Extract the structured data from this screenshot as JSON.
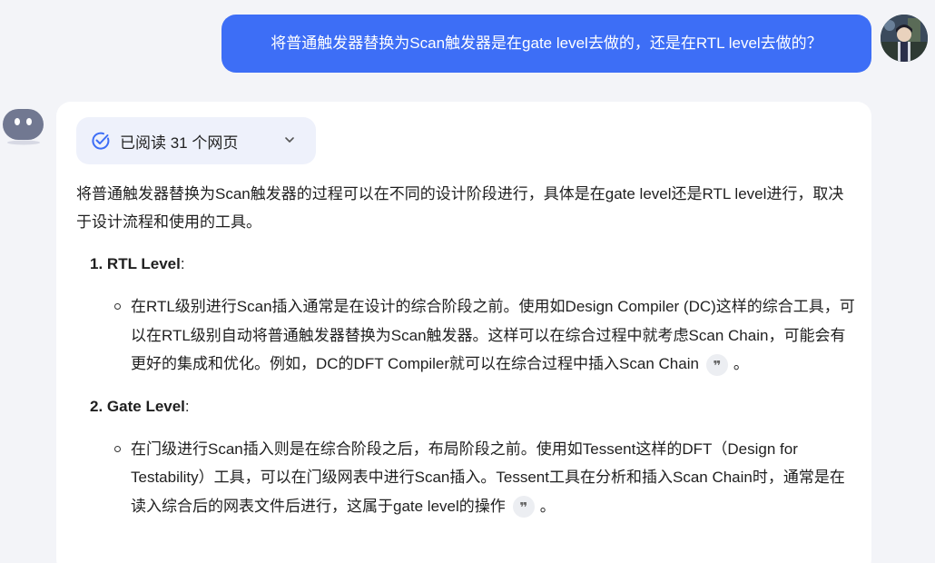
{
  "user_message": {
    "text": "将普通触发器替换为Scan触发器是在gate level去做的，还是在RTL level去做的？"
  },
  "answer": {
    "read_pages_label": "已阅读 31 个网页",
    "intro": "将普通触发器替换为Scan触发器的过程可以在不同的设计阶段进行，具体是在gate level还是RTL level进行，取决于设计流程和使用的工具。",
    "sections": [
      {
        "number": "1.",
        "title": "RTL Level",
        "suffix": ":",
        "bullet_text": "在RTL级别进行Scan插入通常是在设计的综合阶段之前。使用如Design Compiler (DC)这样的综合工具，可以在RTL级别自动将普通触发器替换为Scan触发器。这样可以在综合过程中就考虑Scan Chain，可能会有更好的集成和优化。例如，DC的DFT Compiler就可以在综合过程中插入Scan Chain",
        "bullet_end": "。"
      },
      {
        "number": "2.",
        "title": "Gate Level",
        "suffix": ":",
        "bullet_text": "在门级进行Scan插入则是在综合阶段之后，布局阶段之前。使用如Tessent这样的DFT（Design for Testability）工具，可以在门级网表中进行Scan插入。Tessent工具在分析和插入Scan Chain时，通常是在读入综合后的网表文件后进行，这属于gate level的操作",
        "bullet_end": "。"
      }
    ],
    "citation_glyph": "❞"
  },
  "colors": {
    "user_bubble": "#3d6ef6",
    "background": "#f3f4f8",
    "card": "#ffffff",
    "pill": "#eef1fb",
    "check_accent": "#3d6ef6"
  },
  "icons": {
    "read_check": "check-circle-icon",
    "expand": "chevron-down-icon",
    "citation": "quote-icon",
    "bot": "bot-avatar-icon"
  }
}
